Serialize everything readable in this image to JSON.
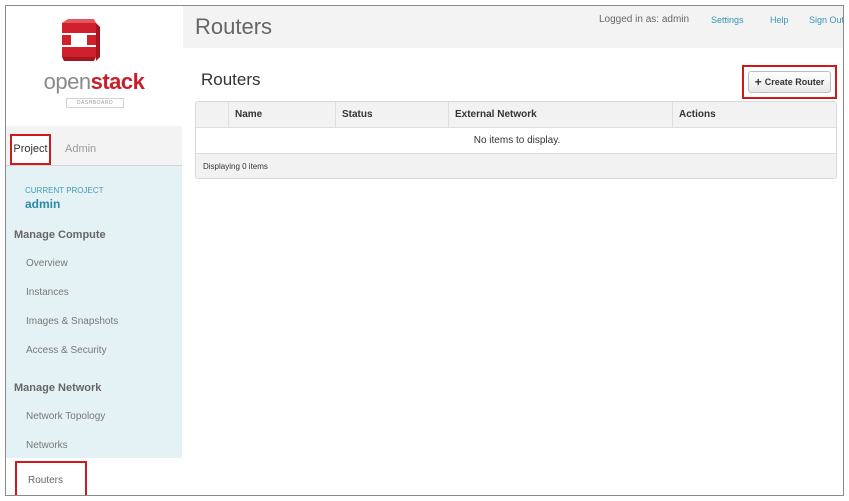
{
  "brand": {
    "open": "open",
    "stack": "stack",
    "sublabel": "DASHBOARD"
  },
  "tabs": {
    "project": "Project",
    "admin": "Admin"
  },
  "current_project": {
    "label": "CURRENT PROJECT",
    "name": "admin"
  },
  "nav": {
    "compute_heading": "Manage Compute",
    "compute_items": [
      "Overview",
      "Instances",
      "Images & Snapshots",
      "Access & Security"
    ],
    "network_heading": "Manage Network",
    "network_items": [
      "Network Topology",
      "Networks",
      "Routers"
    ]
  },
  "header": {
    "title": "Routers",
    "logged_in": "Logged in as: admin",
    "links": [
      "Settings",
      "Help",
      "Sign Out"
    ]
  },
  "main": {
    "section_title": "Routers",
    "create_button": "Create Router",
    "columns": [
      "",
      "Name",
      "Status",
      "External Network",
      "Actions"
    ],
    "empty_message": "No items to display.",
    "footer": "Displaying 0 items"
  },
  "colors": {
    "accent_red": "#d0181f",
    "link_blue": "#3796b6",
    "sidebar_blue": "#e5f2f5"
  },
  "icons": {
    "logo": "openstack-logo-icon",
    "create": "plus-icon"
  }
}
